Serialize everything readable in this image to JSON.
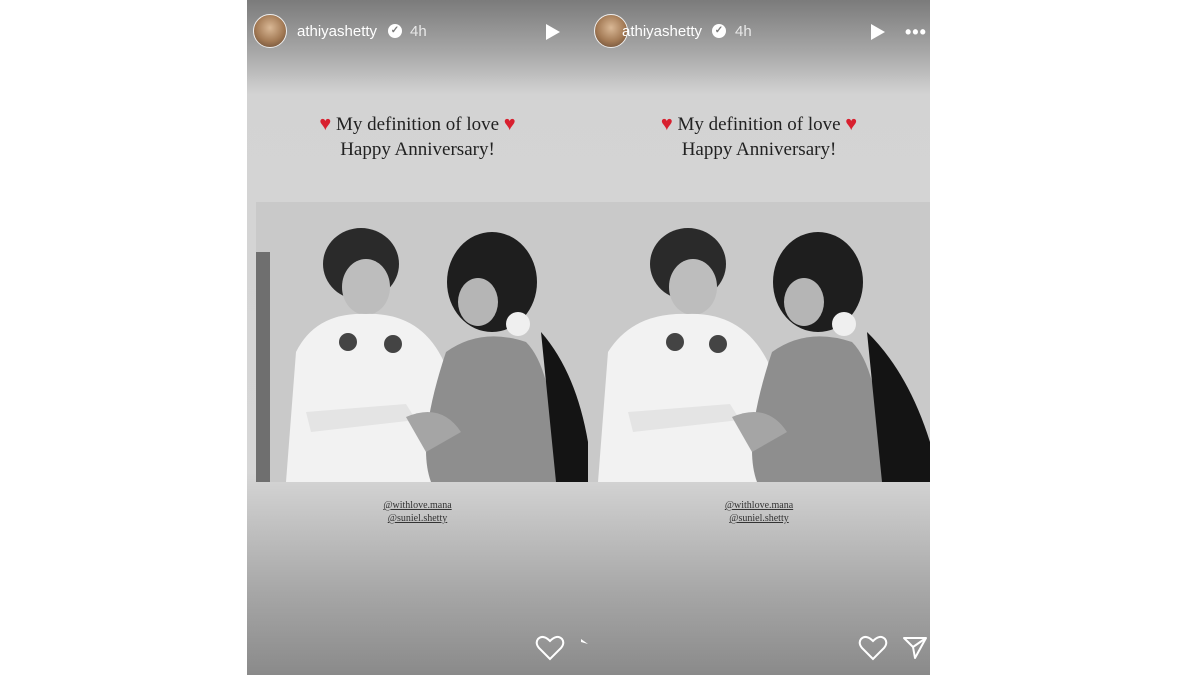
{
  "stories": [
    {
      "username": "athiyashetty",
      "time": "4h",
      "caption_line1": "My definition of love",
      "caption_line2": "Happy Anniversary!",
      "tags": [
        "@withlove.mana",
        "@suniel.shetty"
      ]
    },
    {
      "username": "athiyashetty",
      "time": "4h",
      "caption_line1": "My definition of love",
      "caption_line2": "Happy Anniversary!",
      "tags": [
        "@withlove.mana",
        "@suniel.shetty"
      ]
    }
  ],
  "icons": {
    "verified": "verified-badge-icon",
    "play": "play-icon",
    "more": "more-options-icon",
    "like": "heart-outline-icon",
    "share": "send-icon",
    "heart_emoji": "red-heart-icon"
  },
  "colors": {
    "heart": "#d8202f",
    "text_dark": "#222222",
    "overlay_white": "#ffffff"
  }
}
